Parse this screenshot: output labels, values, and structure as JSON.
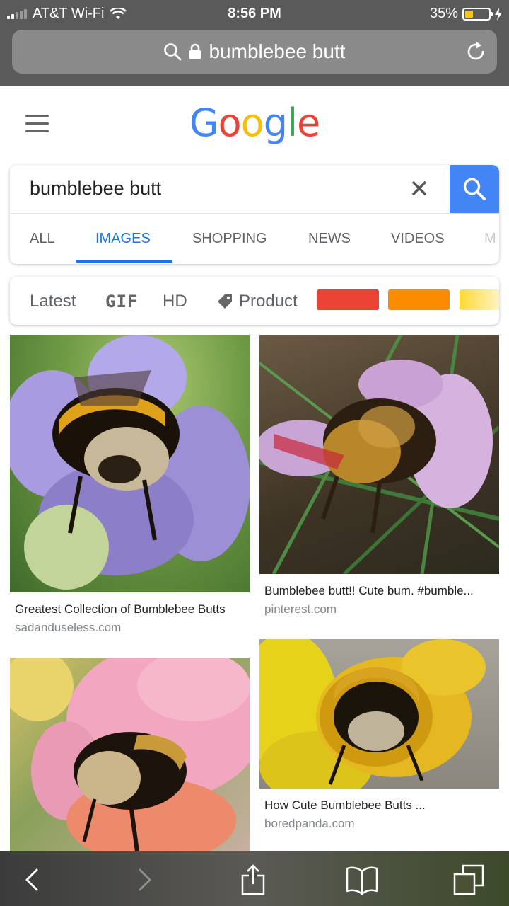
{
  "status_bar": {
    "carrier": "AT&T Wi-Fi",
    "time": "8:56 PM",
    "battery_percent": "35%",
    "battery_level": 0.35,
    "icons": [
      "signal-icon",
      "wifi-icon",
      "battery-icon",
      "charging-bolt-icon"
    ]
  },
  "browser": {
    "url_text": "bumblebee butt",
    "icons": [
      "search-icon",
      "lock-icon",
      "reload-icon"
    ]
  },
  "header": {
    "logo_letters": [
      {
        "ch": "G",
        "color": "#4285F4"
      },
      {
        "ch": "o",
        "color": "#EA4335"
      },
      {
        "ch": "o",
        "color": "#FBBC05"
      },
      {
        "ch": "g",
        "color": "#4285F4"
      },
      {
        "ch": "l",
        "color": "#34A853"
      },
      {
        "ch": "e",
        "color": "#EA4335"
      }
    ]
  },
  "search": {
    "query": "bumblebee butt",
    "tabs": [
      {
        "label": "ALL"
      },
      {
        "label": "IMAGES"
      },
      {
        "label": "SHOPPING"
      },
      {
        "label": "NEWS"
      },
      {
        "label": "VIDEOS"
      },
      {
        "label": "M"
      }
    ],
    "active_tab": "IMAGES",
    "accent": "#4285F4"
  },
  "filters": {
    "latest": "Latest",
    "gif": "GIF",
    "hd": "HD",
    "product": "Product",
    "colors": [
      "#EA4335",
      "#FB8C00",
      "#FDD835"
    ]
  },
  "results": [
    {
      "caption": "Greatest Collection of Bumblebee Butts",
      "source": "sadanduseless.com"
    },
    {
      "caption": "Bumblebee butt!! Cute bum. #bumble...",
      "source": "pinterest.com"
    },
    {
      "caption": "",
      "source": ""
    },
    {
      "caption": "How Cute Bumblebee Butts ...",
      "source": "boredpanda.com"
    }
  ],
  "toolbar": {
    "icons": [
      "back-icon",
      "forward-icon",
      "share-icon",
      "bookmarks-icon",
      "tabs-icon"
    ]
  }
}
